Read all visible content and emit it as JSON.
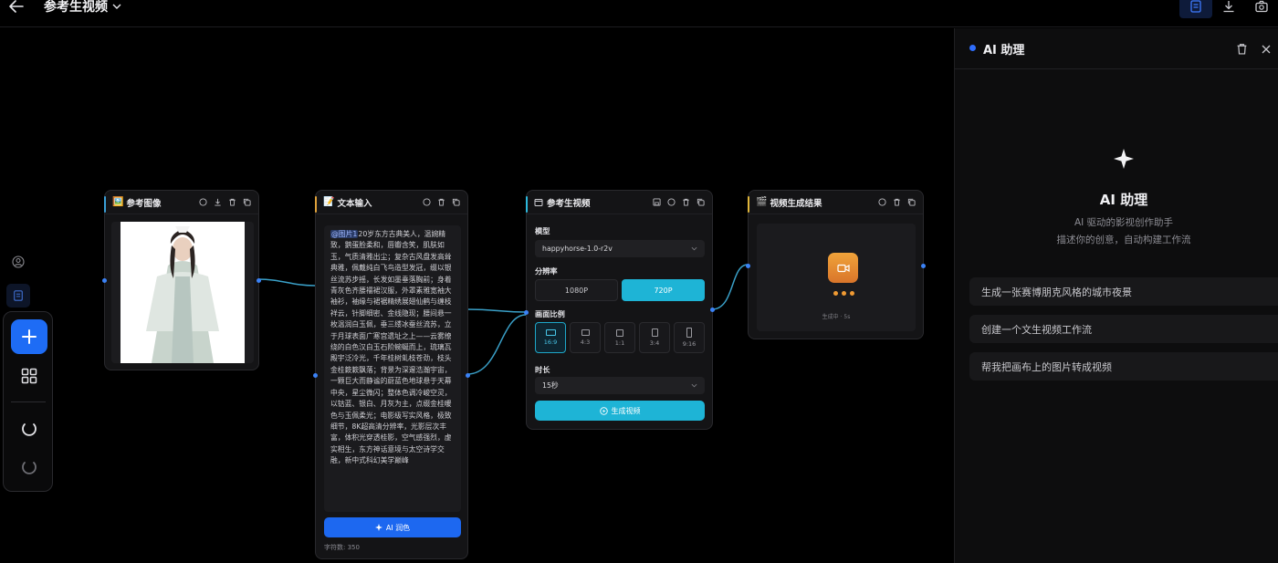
{
  "header": {
    "back_icon": "arrow-left-icon",
    "title": "参考生视频",
    "right_icons": [
      "document-icon",
      "download-icon",
      "camera-icon"
    ]
  },
  "toolbar": {
    "items": [
      "user-icon",
      "document-icon",
      "plus-icon",
      "grid-icon",
      "undo-icon",
      "redo-icon"
    ]
  },
  "nodes": {
    "ref_image": {
      "emoji": "🖼️",
      "title": "参考图像",
      "actions": [
        "comment-icon",
        "download-icon",
        "trash-icon",
        "copy-icon"
      ]
    },
    "text_input": {
      "emoji": "📝",
      "title": "文本输入",
      "actions": [
        "comment-icon",
        "trash-icon",
        "copy-icon"
      ],
      "mention": "@图片1",
      "body": "20岁东方古典美人，温婉精致，鹅蛋脸柔和，唇瓣含笑，肌肤如玉，气质清雅出尘；复杂古风盘发高耸典雅，佩戴纯白飞鸟造型发冠，缀以银丝流苏步摇，长发如墨垂落胸前；身着青灰色齐腰襦裙汉服，外罩素雅宽袖大袖衫，袖缘与裙裾精绣展翅仙鹤与缠枝祥云，针脚细密、金线隐现；腰间悬一枚温润白玉佩，垂三缕冰蚕丝流苏，立于月球表面广寒宫遗址之上——云雾缭绕的白色汉白玉石阶蜿蜒而上，琉璃瓦殿宇泛冷光，千年桂树虬枝苍劲，枝头金桂簌簌飘落；背景为深邃浩瀚宇宙，一颗巨大而静谧的蔚蓝色地球悬于天幕中央，星尘微闪；整体色调冷峻空灵，以钴蓝、银白、月灰为主，点缀金桂暖色与玉佩柔光；电影级写实风格，极致细节，8K超高清分辨率，光影层次丰富，体积光穿透桂影，空气感强烈，虚实相生，东方神话意境与太空诗学交融，新中式科幻美学巅峰",
      "ai_button": "AI 润色",
      "char_count": "字符数: 350"
    },
    "ref_video": {
      "title": "参考生视频",
      "actions": [
        "save-icon",
        "comment-icon",
        "trash-icon",
        "copy-icon"
      ],
      "model_label": "模型",
      "model_value": "happyhorse-1.0-r2v",
      "resolution_label": "分辨率",
      "resolutions": [
        "1080P",
        "720P"
      ],
      "resolution_selected": "720P",
      "ratio_label": "画面比例",
      "ratios": [
        "16:9",
        "4:3",
        "1:1",
        "3:4",
        "9:16"
      ],
      "ratio_selected": "16:9",
      "duration_label": "时长",
      "duration_value": "15秒",
      "generate_button": "生成视频"
    },
    "video_result": {
      "emoji": "🎬",
      "title": "视频生成结果",
      "actions": [
        "comment-icon",
        "trash-icon",
        "copy-icon"
      ],
      "status": "生成中 · 5s"
    }
  },
  "assistant": {
    "header_title": "AI 助理",
    "title": "AI 助理",
    "subtitle_1": "AI 驱动的影视创作助手",
    "subtitle_2": "描述你的创意，自动构建工作流",
    "suggestions": [
      "生成一张赛博朋克风格的城市夜景",
      "创建一个文生视频工作流",
      "帮我把画布上的图片转成视频"
    ]
  },
  "colors": {
    "accent_blue": "#1e6cf5",
    "accent_cyan": "#1eb4d6",
    "progress_orange": "#f09a33"
  }
}
